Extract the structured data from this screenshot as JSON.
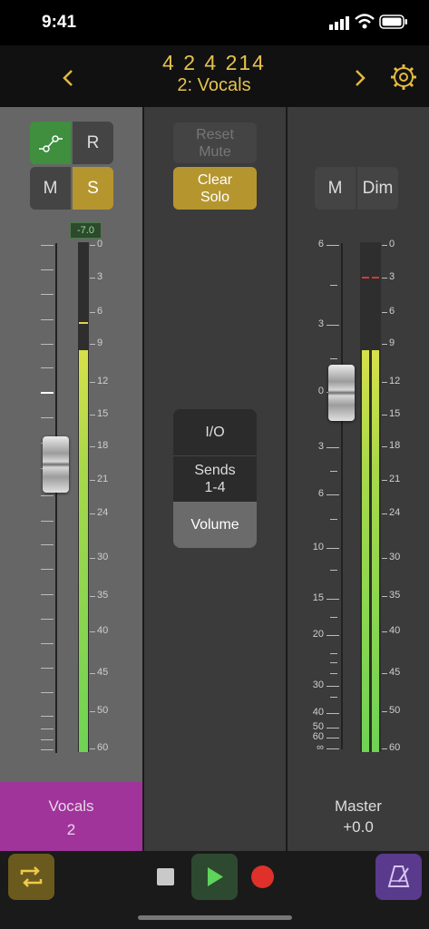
{
  "status_bar": {
    "time": "9:41"
  },
  "header": {
    "position": "4  2  4  214",
    "track": "2: Vocals",
    "prev_icon": "chevron-left-icon",
    "next_icon": "chevron-right-icon",
    "settings_icon": "gear-icon"
  },
  "left_strip": {
    "automation_icon": "automation-curve-icon",
    "record_label": "R",
    "mute_label": "M",
    "solo_label": "S",
    "peak_value": "-7.0",
    "meter_level_db": -9,
    "meter_ticks": [
      "0",
      "3",
      "6",
      "9",
      "12",
      "15",
      "18",
      "21",
      "24",
      "30",
      "35",
      "40",
      "45",
      "50",
      "60"
    ],
    "track_name": "Vocals",
    "track_number": "2",
    "track_color": "#a0349a"
  },
  "middle_strip": {
    "reset_mute": "Reset\nMute",
    "clear_solo": "Clear\nSolo",
    "tabs": [
      {
        "label": "I/O"
      },
      {
        "label": "Sends\n1-4"
      },
      {
        "label": "Volume"
      }
    ]
  },
  "right_strip": {
    "mute_label": "M",
    "dim_label": "Dim",
    "fader_scale": [
      "6",
      "3",
      "0",
      "3",
      "6",
      "10",
      "15",
      "20",
      "30",
      "40",
      "50",
      "60",
      "∞"
    ],
    "meter_ticks": [
      "0",
      "3",
      "6",
      "9",
      "12",
      "15",
      "18",
      "21",
      "24",
      "30",
      "35",
      "40",
      "45",
      "50",
      "60"
    ],
    "name": "Master",
    "value": "+0.0",
    "peak_hold_db": -3,
    "meter_level_db": -9
  },
  "bottom_bar": {
    "cycle_icon": "cycle-icon",
    "stop_icon": "stop-icon",
    "play_icon": "play-icon",
    "record_icon": "record-icon",
    "metronome_icon": "metronome-icon"
  },
  "colors": {
    "accent": "#e6c24e",
    "solo": "#b5962e",
    "automation": "#3f8f3f",
    "track": "#a0349a",
    "metronome": "#5a3a8c"
  }
}
